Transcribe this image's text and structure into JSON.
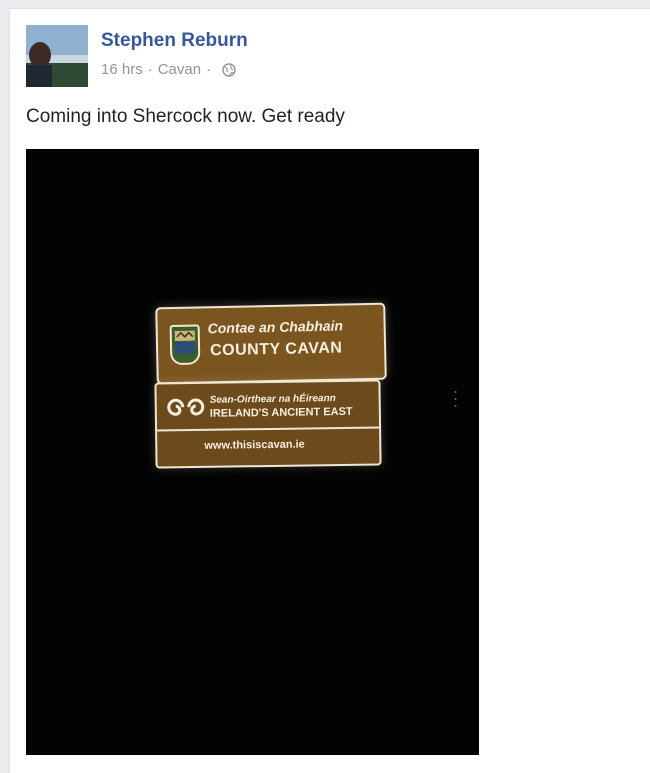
{
  "post": {
    "author": "Stephen Reburn",
    "time": "16 hrs",
    "location": "Cavan",
    "separator": "·",
    "text": "Coming into Shercock now. Get ready"
  },
  "photo": {
    "sign_irish": "Contae an Chabhain",
    "sign_county": "COUNTY CAVAN",
    "sign_east_irish": "Sean-Oirthear na hÉireann",
    "sign_east": "IRELAND'S ANCIENT EAST",
    "sign_url": "www.thisiscavan.ie"
  },
  "icons": {
    "privacy": "globe-icon",
    "avatar": "profile-photo"
  },
  "colors": {
    "author_link": "#365899",
    "meta_text": "#90949c",
    "body_text": "#1d2129",
    "sign_brown": "#7a5520"
  }
}
